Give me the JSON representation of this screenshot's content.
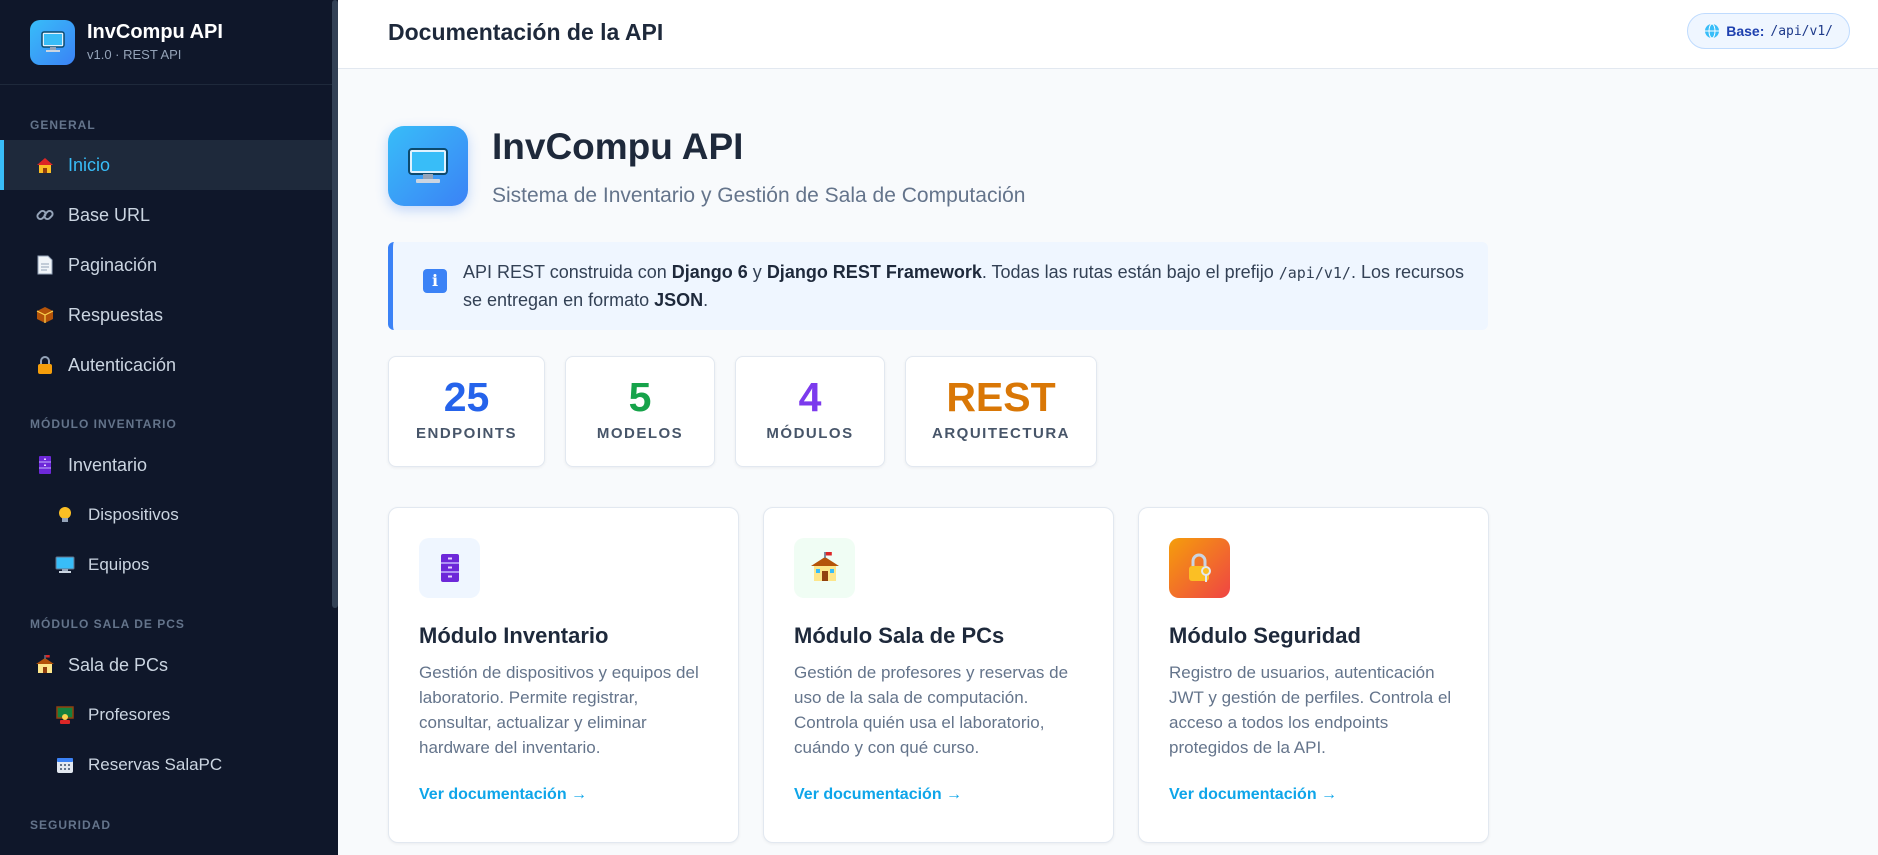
{
  "brand": {
    "title": "InvCompu API",
    "subtitle": "v1.0 · REST API"
  },
  "sidebar": {
    "sections": [
      {
        "label": "GENERAL"
      },
      {
        "label": "MÓDULO INVENTARIO"
      },
      {
        "label": "MÓDULO SALA DE PCS"
      },
      {
        "label": "SEGURIDAD"
      }
    ],
    "items": [
      {
        "label": "Inicio",
        "icon": "house-icon"
      },
      {
        "label": "Base URL",
        "icon": "link-icon"
      },
      {
        "label": "Paginación",
        "icon": "page-icon"
      },
      {
        "label": "Respuestas",
        "icon": "package-icon"
      },
      {
        "label": "Autenticación",
        "icon": "lock-icon"
      },
      {
        "label": "Inventario",
        "icon": "cabinet-icon"
      },
      {
        "label": "Dispositivos",
        "icon": "bulb-icon"
      },
      {
        "label": "Equipos",
        "icon": "computer-icon"
      },
      {
        "label": "Sala de PCs",
        "icon": "school-icon"
      },
      {
        "label": "Profesores",
        "icon": "teacher-icon"
      },
      {
        "label": "Reservas SalaPC",
        "icon": "calendar-icon"
      }
    ]
  },
  "topbar": {
    "title": "Documentación de la API",
    "base_label": "Base:",
    "base_path": "/api/v1/"
  },
  "hero": {
    "title": "InvCompu API",
    "subtitle": "Sistema de Inventario y Gestión de Sala de Computación"
  },
  "info": {
    "t1": "API REST construida con ",
    "b1": "Django 6",
    "t2": " y ",
    "b2": "Django REST Framework",
    "t3": ". Todas las rutas están bajo el prefijo ",
    "code": "/api/v1/",
    "t4": ". Los recursos se entregan en formato ",
    "b3": "JSON",
    "t5": "."
  },
  "stats": [
    {
      "value": "25",
      "label": "ENDPOINTS",
      "color": "#2563eb"
    },
    {
      "value": "5",
      "label": "MODELOS",
      "color": "#16a34a"
    },
    {
      "value": "4",
      "label": "MÓDULOS",
      "color": "#7c3aed"
    },
    {
      "value": "REST",
      "label": "ARQUITECTURA",
      "color": "#d97706"
    }
  ],
  "cards": [
    {
      "title": "Módulo Inventario",
      "desc": "Gestión de dispositivos y equipos del laboratorio. Permite registrar, consultar, actualizar y eliminar hardware del inventario.",
      "link": "Ver documentación →",
      "icon": "cabinet-icon"
    },
    {
      "title": "Módulo Sala de PCs",
      "desc": "Gestión de profesores y reservas de uso de la sala de computación. Controla quién usa el laboratorio, cuándo y con qué curso.",
      "link": "Ver documentación →",
      "icon": "school-icon"
    },
    {
      "title": "Módulo Seguridad",
      "desc": "Registro de usuarios, autenticación JWT y gestión de perfiles. Controla el acceso a todos los endpoints protegidos de la API.",
      "link": "Ver documentación →",
      "icon": "lock-key-icon"
    }
  ]
}
